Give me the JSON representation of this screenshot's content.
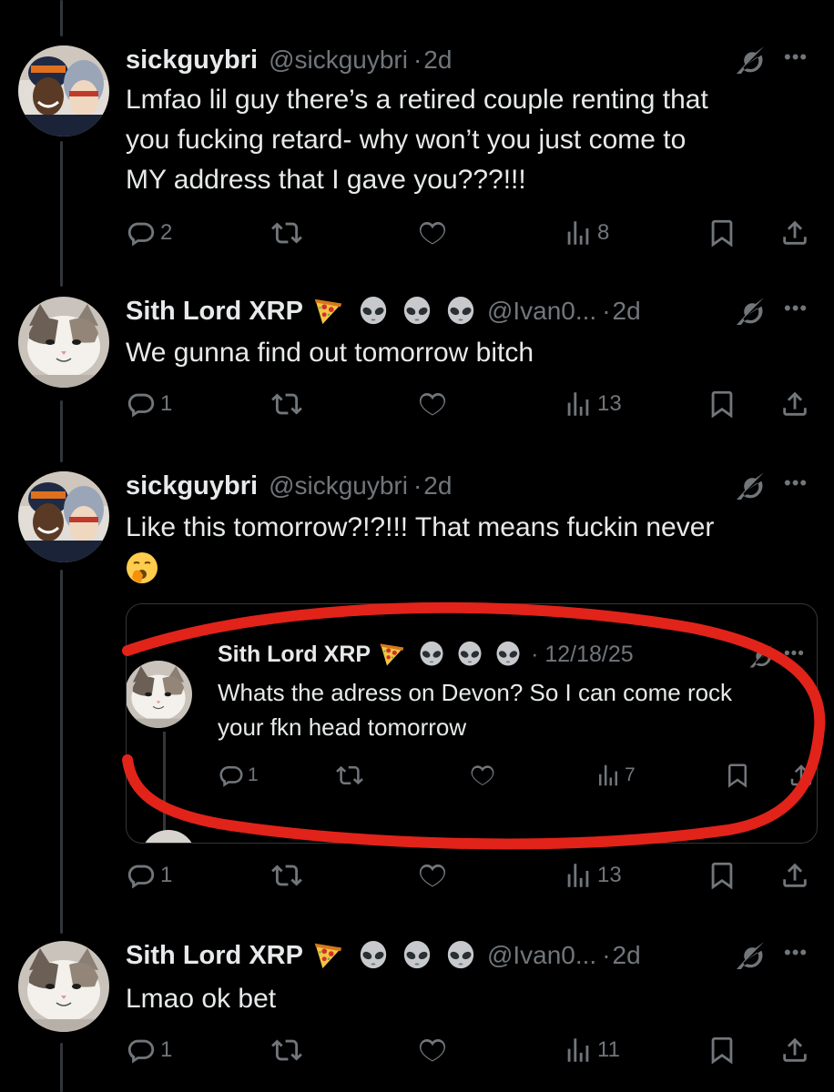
{
  "colors": {
    "background": "#000000",
    "text_primary": "#e7e9ea",
    "text_secondary": "#71767b",
    "thread_line": "#333639",
    "annotation_red": "#e2231a"
  },
  "tweets": [
    {
      "name": "sickguybri",
      "handle": "@sickguybri",
      "dot": "·",
      "time": "2d",
      "emojis": [],
      "avatar_icon": "couple-selfie-avatar",
      "text_lines": [
        "Lmfao lil guy there’s a retired couple renting that",
        "you fucking retard- why won’t you just come to",
        "MY address that I gave you???!!!"
      ],
      "replies": "2",
      "retweets": "",
      "likes": "",
      "views": "8"
    },
    {
      "name": "Sith Lord XRP",
      "handle": "@Ivan0...",
      "dot": "·",
      "time": "2d",
      "emojis": [
        "pizza-emoji",
        "alien-emoji",
        "alien-emoji",
        "alien-emoji"
      ],
      "avatar_icon": "cat-avatar",
      "text_lines": [
        "We gunna find out tomorrow bitch"
      ],
      "replies": "1",
      "retweets": "",
      "likes": "",
      "views": "13"
    },
    {
      "name": "sickguybri",
      "handle": "@sickguybri",
      "dot": "·",
      "time": "2d",
      "emojis": [],
      "avatar_icon": "couple-selfie-avatar",
      "text_lines": [
        "Like this tomorrow?!?!!! That means fuckin never"
      ],
      "trailing_emoji": "yawning-face-emoji",
      "replies": "1",
      "retweets": "",
      "likes": "",
      "views": "13",
      "quote": {
        "name": "Sith Lord XRP",
        "emojis": [
          "pizza-emoji",
          "alien-emoji",
          "alien-emoji",
          "alien-emoji"
        ],
        "time": "· 12/18/25",
        "text_lines": [
          "Whats the adress on Devon? So I can come rock",
          "your fkn head tomorrow"
        ],
        "replies": "1",
        "views": "7"
      }
    },
    {
      "name": "Sith Lord XRP",
      "handle": "@Ivan0...",
      "dot": "·",
      "time": "2d",
      "emojis": [
        "pizza-emoji",
        "alien-emoji",
        "alien-emoji",
        "alien-emoji"
      ],
      "avatar_icon": "cat-avatar",
      "text_lines": [
        "Lmao ok bet"
      ],
      "replies": "1",
      "retweets": "",
      "likes": "",
      "views": "11"
    }
  ],
  "icons": {
    "more": "more-icon",
    "grok": "grok-icon",
    "reply": "reply-icon",
    "retweet": "retweet-icon",
    "like": "heart-icon",
    "views": "views-icon",
    "bookmark": "bookmark-icon",
    "share": "share-icon"
  }
}
